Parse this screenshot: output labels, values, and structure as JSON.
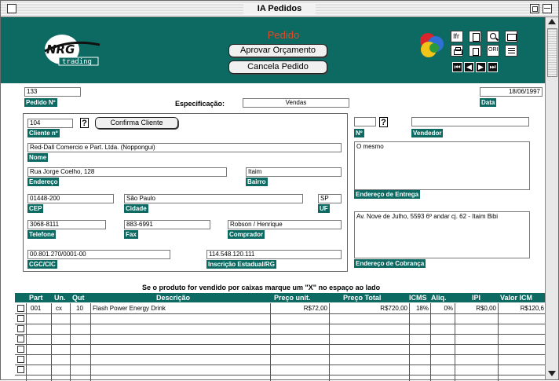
{
  "window": {
    "title": "IA Pedidos"
  },
  "header": {
    "logo_text": "NRG trading",
    "pedido_label": "Pedido",
    "aprovar_button": "Aprovar Orçamento",
    "cancela_button": "Cancela Pedido"
  },
  "colors": {
    "header_bg": "#0c6a62",
    "pedido_title": "#e34a28"
  },
  "order": {
    "number": "133",
    "number_label": "Pedido Nº",
    "especificacao_label": "Especificação:",
    "especificacao_value": "Vendas",
    "date": "18/06/1997",
    "date_label": "Data"
  },
  "client": {
    "number": "104",
    "number_label": "Cliente nº",
    "help": "?",
    "confirm_button": "Confirma Cliente",
    "nome": "Red-Dall Comercio e Part. Ltda. (Noppongui)",
    "nome_label": "Nome",
    "endereco": "Rua Jorge Coelho, 128",
    "endereco_label": "Endereço",
    "bairro": "Itaim",
    "bairro_label": "Bairro",
    "cep": "01448-200",
    "cep_label": "CEP",
    "cidade": "São Paulo",
    "cidade_label": "Cidade",
    "uf": "SP",
    "uf_label": "UF",
    "telefone": "3068-8111",
    "telefone_label": "Telefone",
    "fax": "883-6991",
    "fax_label": "Fax",
    "comprador": "Robson / Henrique",
    "comprador_label": "Comprador",
    "cgc": "00.801.270/0001-00",
    "cgc_label": "CGC/CIC",
    "inscricao": "114.548.120.111",
    "inscricao_label": "Inscrição Estadual/RG"
  },
  "seller": {
    "number_label": "Nº",
    "help": "?",
    "vendedor_label": "Vendedor",
    "entrega_value": "O mesmo",
    "entrega_label": "Endereço de Entrega",
    "cobranca_value": "Av. Nove de Julho, 5593 6º andar cj. 62 - Itaim Bibi",
    "cobranca_label": "Endereço de Cobrança"
  },
  "items": {
    "note": "Se o produto for vendido por caixas marque um \"X\" no espaço ao lado",
    "headers": [
      "Part",
      "Un.",
      "Qut",
      "Descrição",
      "Preço unit.",
      "Preço Total",
      "ICMS",
      "Aliq.",
      "IPI",
      "Valor ICM"
    ],
    "rows": [
      {
        "part": "001",
        "un": "cx",
        "qut": "10",
        "descricao": "Flash Power Energy Drink",
        "preco_unit": "R$72,00",
        "preco_total": "R$720,00",
        "icms": "18%",
        "aliq": "0%",
        "ipi": "R$0,00",
        "valor_icm": "R$120,6"
      }
    ]
  }
}
